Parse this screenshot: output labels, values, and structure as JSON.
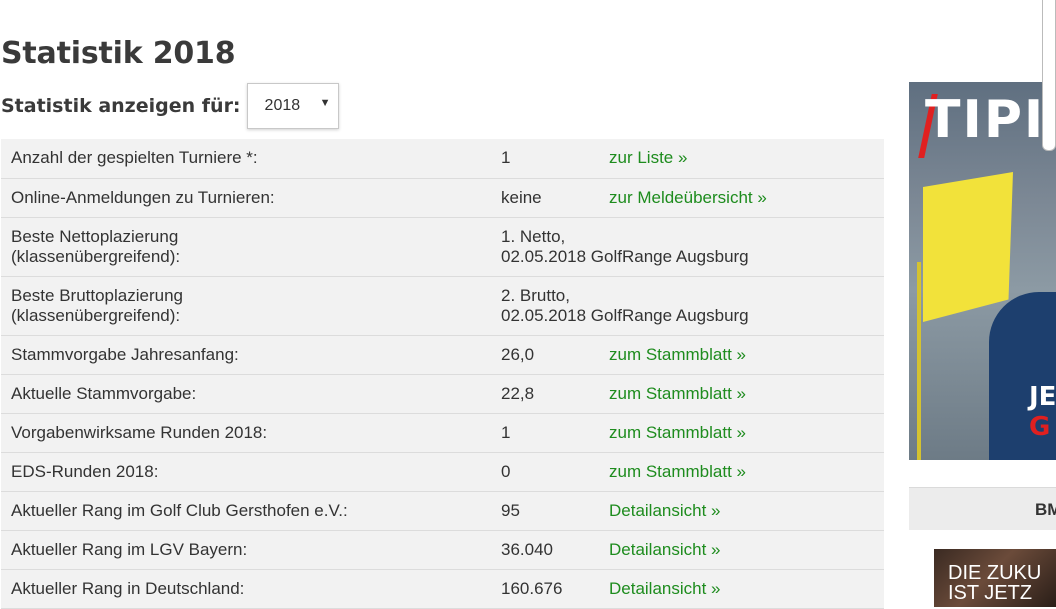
{
  "page": {
    "title": "Statistik 2018"
  },
  "filter": {
    "label": "Statistik anzeigen für:",
    "selected_year": "2018"
  },
  "rows": [
    {
      "label": "Anzahl der gespielten Turniere *:",
      "value": "1",
      "link": "zur Liste »"
    },
    {
      "label": "Online-Anmeldungen zu Turnieren:",
      "value": "keine",
      "link": "zur Meldeübersicht »"
    },
    {
      "label_line1": "Beste Nettoplazierung",
      "label_line2": "(klassenübergreifend):",
      "value_line1": "1. Netto,",
      "value_line2": "02.05.2018 GolfRange Augsburg"
    },
    {
      "label_line1": "Beste Bruttoplazierung",
      "label_line2": "(klassenübergreifend):",
      "value_line1": "2. Brutto,",
      "value_line2": "02.05.2018 GolfRange Augsburg"
    },
    {
      "label": "Stammvorgabe Jahresanfang:",
      "value": "26,0",
      "link": "zum Stammblatt »"
    },
    {
      "label": "Aktuelle Stammvorgabe:",
      "value": "22,8",
      "link": "zum Stammblatt »"
    },
    {
      "label": "Vorgabenwirksame Runden 2018:",
      "value": "1",
      "link": "zum Stammblatt »"
    },
    {
      "label": "EDS-Runden 2018:",
      "value": "0",
      "link": "zum Stammblatt »"
    },
    {
      "label": "Aktueller Rang im Golf Club Gersthofen e.V.:",
      "value": "95",
      "link": "Detailansicht »"
    },
    {
      "label": "Aktueller Rang im LGV Bayern:",
      "value": "36.040",
      "link": "Detailansicht »"
    },
    {
      "label": "Aktueller Rang in Deutschland:",
      "value": "160.676",
      "link": "Detailansicht »"
    }
  ],
  "sidebar": {
    "ad": {
      "headline": "TIPI",
      "text_line1": "JE",
      "text_line2": "G"
    },
    "promo": {
      "header": "BM",
      "text_line1": "DIE ZUKU",
      "text_line2": "IST JETZ"
    }
  },
  "colors": {
    "link": "#1e8c1e",
    "row_bg": "#f2f2f2",
    "row_border": "#dcdcdc",
    "ad_accent": "#e02020"
  }
}
